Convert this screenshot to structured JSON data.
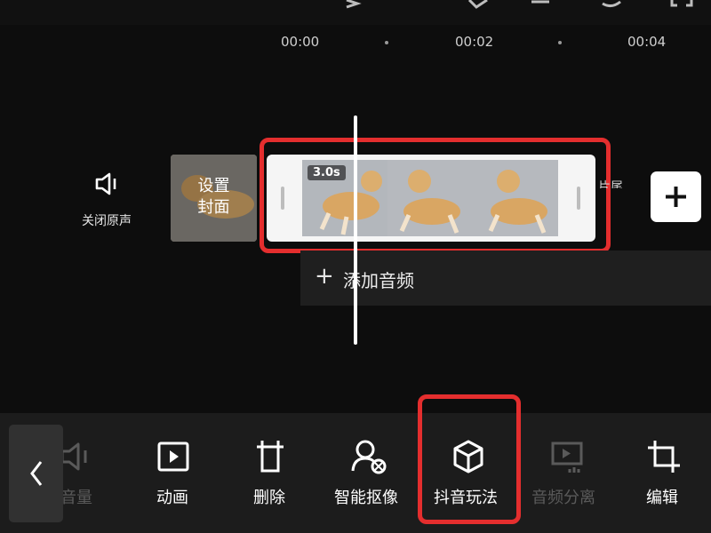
{
  "ruler": {
    "t0": "00:00",
    "t1": "00:02",
    "t2": "00:04"
  },
  "mute": {
    "label": "关闭原声"
  },
  "cover": {
    "line1": "设置",
    "line2": "封面"
  },
  "clip": {
    "duration": "3.0s",
    "partial_label": "片尾"
  },
  "audio": {
    "plus": "+",
    "label": "添加音频"
  },
  "toolbar": {
    "items": [
      {
        "label": "音量",
        "icon": "volume-icon",
        "enabled": false
      },
      {
        "label": "动画",
        "icon": "animation-play-icon",
        "enabled": true
      },
      {
        "label": "删除",
        "icon": "delete-icon",
        "enabled": true
      },
      {
        "label": "智能抠像",
        "icon": "smart-cutout-icon",
        "enabled": true
      },
      {
        "label": "抖音玩法",
        "icon": "cube-icon",
        "enabled": true
      },
      {
        "label": "音频分离",
        "icon": "audio-separate-icon",
        "enabled": false
      },
      {
        "label": "编辑",
        "icon": "crop-edit-icon",
        "enabled": true
      }
    ]
  },
  "colors": {
    "highlight": "#e42e2e",
    "background": "#0d0d0d",
    "toolbar": "#1c1c1c"
  }
}
